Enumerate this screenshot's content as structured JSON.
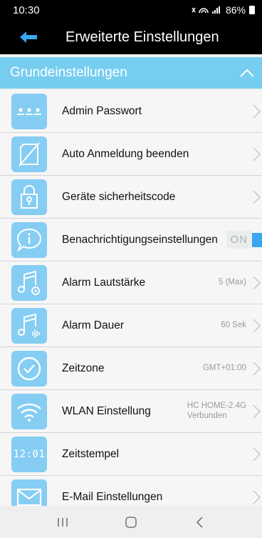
{
  "status": {
    "time": "10:30",
    "indicators": "¥̸ ≋.░ 86%",
    "battery_icon": "battery-icon"
  },
  "header": {
    "title": "Erweiterte Einstellungen",
    "back_icon": "back-arrow-icon"
  },
  "section": {
    "label": "Grundeinstellungen",
    "collapse_icon": "chevron-up-icon"
  },
  "items": [
    {
      "label": "Admin Passwort",
      "icon": "password-dots-icon"
    },
    {
      "label": "Auto Anmeldung beenden",
      "icon": "no-device-icon"
    },
    {
      "label": "Geräte sicherheitscode",
      "icon": "lock-icon"
    },
    {
      "label": "Benachrichtigungseinstellungen",
      "icon": "info-bubble-icon",
      "toggle": "ON"
    },
    {
      "label": "Alarm Lautstärke",
      "icon": "music-gear-icon",
      "value": "5 (Max)"
    },
    {
      "label": "Alarm Dauer",
      "icon": "music-wave-icon",
      "value": "60 Sek"
    },
    {
      "label": "Zeitzone",
      "icon": "check-clock-icon",
      "value": "GMT+01:00"
    },
    {
      "label": "WLAN Einstellung",
      "icon": "wifi-icon",
      "value": "HC HOME-2.4G",
      "value2": "Verbunden"
    },
    {
      "label": "Zeitstempel",
      "icon": "digital-clock-icon",
      "icon_text": "12:01"
    },
    {
      "label": "E-Mail Einstellungen",
      "icon": "mail-icon"
    }
  ],
  "colors": {
    "accent": "#76cdf0",
    "icon_bg": "#85cdf3",
    "toggle": "#3aa6f0"
  }
}
